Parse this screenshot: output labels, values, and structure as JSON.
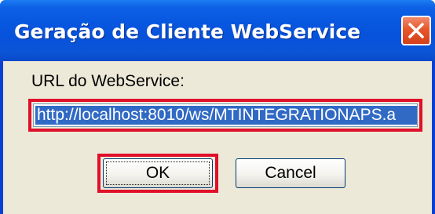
{
  "window": {
    "title": "Geração de Cliente WebService"
  },
  "form": {
    "url_label": "URL do WebService:",
    "url_value": "http://localhost:8010/ws/MTINTEGRATIONAPS.a"
  },
  "buttons": {
    "ok_label": "OK",
    "cancel_label": "Cancel"
  },
  "colors": {
    "titlebar": "#0857e0",
    "dialog_face": "#ece9d8",
    "selection": "#316ac5",
    "highlight_box": "#e0102a",
    "close_button": "#e6562b"
  },
  "icons": {
    "close": "close-icon"
  }
}
